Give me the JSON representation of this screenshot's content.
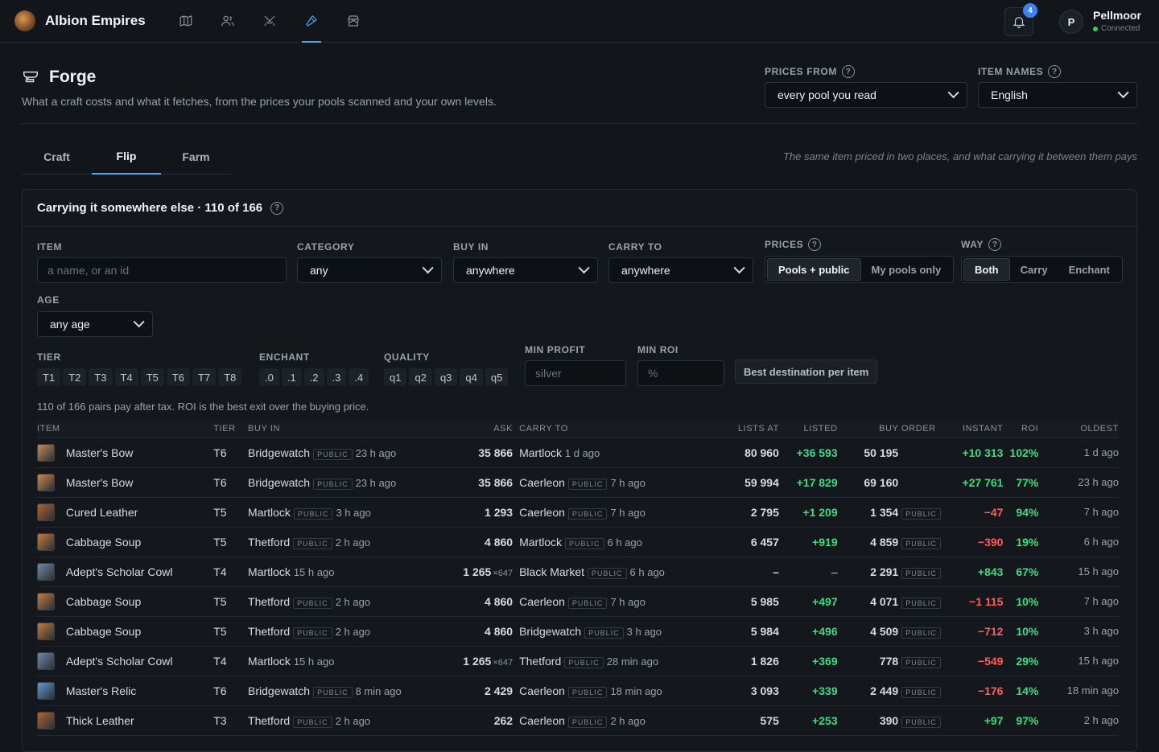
{
  "app": {
    "title": "Albion Empires",
    "notifications": "4",
    "user_initial": "P",
    "user_name": "Pellmoor",
    "user_status": "Connected"
  },
  "page": {
    "title": "Forge",
    "subtitle": "What a craft costs and what it fetches, from the prices your pools scanned and your own levels."
  },
  "prices_from": {
    "label": "PRICES FROM",
    "value": "every pool you read"
  },
  "item_names": {
    "label": "ITEM NAMES",
    "value": "English"
  },
  "tabs": [
    {
      "label": "Craft"
    },
    {
      "label": "Flip"
    },
    {
      "label": "Farm"
    }
  ],
  "tab_hint": "The same item priced in two places, and what carrying it between them pays",
  "card": {
    "title": "Carrying it somewhere else · 110 of 166"
  },
  "filters": {
    "item_label": "ITEM",
    "item_placeholder": "a name, or an id",
    "category_label": "CATEGORY",
    "category_value": "any",
    "buyin_label": "BUY IN",
    "buyin_value": "anywhere",
    "carryto_label": "CARRY TO",
    "carryto_value": "anywhere",
    "prices_label": "PRICES",
    "prices_options": [
      "Pools + public",
      "My pools only"
    ],
    "way_label": "WAY",
    "way_options": [
      "Both",
      "Carry",
      "Enchant"
    ],
    "age_label": "AGE",
    "age_value": "any age",
    "tier_label": "TIER",
    "tiers": [
      "T1",
      "T2",
      "T3",
      "T4",
      "T5",
      "T6",
      "T7",
      "T8"
    ],
    "enchant_label": "ENCHANT",
    "enchants": [
      ".0",
      ".1",
      ".2",
      ".3",
      ".4"
    ],
    "quality_label": "QUALITY",
    "qualities": [
      "q1",
      "q2",
      "q3",
      "q4",
      "q5"
    ],
    "min_profit_label": "MIN PROFIT",
    "min_profit_placeholder": "silver",
    "min_roi_label": "MIN ROI",
    "min_roi_placeholder": "%",
    "best_button": "Best destination per item"
  },
  "summary": "110 of 166 pairs pay after tax. ROI is the best exit over the buying price.",
  "columns": [
    "ITEM",
    "TIER",
    "BUY IN",
    "ASK",
    "CARRY TO",
    "LISTS AT",
    "LISTED",
    "BUY ORDER",
    "INSTANT",
    "ROI",
    "OLDEST"
  ],
  "public_tag": "PUBLIC",
  "rows": [
    {
      "item": "Master's Bow",
      "tier": "T6",
      "buy": "Bridgewatch",
      "buy_pub": true,
      "buy_ago": "23 h ago",
      "ask": "35 866",
      "mult": "",
      "carry": "Martlock",
      "carry_pub": false,
      "carry_ago": "1 d ago",
      "lists": "80 960",
      "listed": "+36 593",
      "order": "50 195",
      "order_pub": false,
      "instant": "+10 313",
      "roi": "102%",
      "oldest": "1 d ago",
      "color": "#c98a4a"
    },
    {
      "item": "Master's Bow",
      "tier": "T6",
      "buy": "Bridgewatch",
      "buy_pub": true,
      "buy_ago": "23 h ago",
      "ask": "35 866",
      "mult": "",
      "carry": "Caerleon",
      "carry_pub": true,
      "carry_ago": "7 h ago",
      "lists": "59 994",
      "listed": "+17 829",
      "order": "69 160",
      "order_pub": false,
      "instant": "+27 761",
      "roi": "77%",
      "oldest": "23 h ago",
      "color": "#c98a4a"
    },
    {
      "item": "Cured Leather",
      "tier": "T5",
      "buy": "Martlock",
      "buy_pub": true,
      "buy_ago": "3 h ago",
      "ask": "1 293",
      "mult": "",
      "carry": "Caerleon",
      "carry_pub": true,
      "carry_ago": "7 h ago",
      "lists": "2 795",
      "listed": "+1 209",
      "order": "1 354",
      "order_pub": true,
      "instant": "−47",
      "roi": "94%",
      "oldest": "7 h ago",
      "color": "#b4622e"
    },
    {
      "item": "Cabbage Soup",
      "tier": "T5",
      "buy": "Thetford",
      "buy_pub": true,
      "buy_ago": "2 h ago",
      "ask": "4 860",
      "mult": "",
      "carry": "Martlock",
      "carry_pub": true,
      "carry_ago": "6 h ago",
      "lists": "6 457",
      "listed": "+919",
      "order": "4 859",
      "order_pub": true,
      "instant": "−390",
      "roi": "19%",
      "oldest": "6 h ago",
      "color": "#c77a3c"
    },
    {
      "item": "Adept's Scholar Cowl",
      "tier": "T4",
      "buy": "Martlock",
      "buy_pub": false,
      "buy_ago": "15 h ago",
      "ask": "1 265",
      "mult": "×647",
      "carry": "Black Market",
      "carry_pub": true,
      "carry_ago": "6 h ago",
      "lists": "–",
      "listed": "–",
      "order": "2 291",
      "order_pub": true,
      "instant": "+843",
      "roi": "67%",
      "oldest": "15 h ago",
      "color": "#6f8aa8"
    },
    {
      "item": "Cabbage Soup",
      "tier": "T5",
      "buy": "Thetford",
      "buy_pub": true,
      "buy_ago": "2 h ago",
      "ask": "4 860",
      "mult": "",
      "carry": "Caerleon",
      "carry_pub": true,
      "carry_ago": "7 h ago",
      "lists": "5 985",
      "listed": "+497",
      "order": "4 071",
      "order_pub": true,
      "instant": "−1 115",
      "roi": "10%",
      "oldest": "7 h ago",
      "color": "#c77a3c"
    },
    {
      "item": "Cabbage Soup",
      "tier": "T5",
      "buy": "Thetford",
      "buy_pub": true,
      "buy_ago": "2 h ago",
      "ask": "4 860",
      "mult": "",
      "carry": "Bridgewatch",
      "carry_pub": true,
      "carry_ago": "3 h ago",
      "lists": "5 984",
      "listed": "+496",
      "order": "4 509",
      "order_pub": true,
      "instant": "−712",
      "roi": "10%",
      "oldest": "3 h ago",
      "color": "#c77a3c"
    },
    {
      "item": "Adept's Scholar Cowl",
      "tier": "T4",
      "buy": "Martlock",
      "buy_pub": false,
      "buy_ago": "15 h ago",
      "ask": "1 265",
      "mult": "×647",
      "carry": "Thetford",
      "carry_pub": true,
      "carry_ago": "28 min ago",
      "lists": "1 826",
      "listed": "+369",
      "order": "778",
      "order_pub": true,
      "instant": "−549",
      "roi": "29%",
      "oldest": "15 h ago",
      "color": "#6f8aa8"
    },
    {
      "item": "Master's Relic",
      "tier": "T6",
      "buy": "Bridgewatch",
      "buy_pub": true,
      "buy_ago": "8 min ago",
      "ask": "2 429",
      "mult": "",
      "carry": "Caerleon",
      "carry_pub": true,
      "carry_ago": "18 min ago",
      "lists": "3 093",
      "listed": "+339",
      "order": "2 449",
      "order_pub": true,
      "instant": "−176",
      "roi": "14%",
      "oldest": "18 min ago",
      "color": "#5b9bd5"
    },
    {
      "item": "Thick Leather",
      "tier": "T3",
      "buy": "Thetford",
      "buy_pub": true,
      "buy_ago": "2 h ago",
      "ask": "262",
      "mult": "",
      "carry": "Caerleon",
      "carry_pub": true,
      "carry_ago": "2 h ago",
      "lists": "575",
      "listed": "+253",
      "order": "390",
      "order_pub": true,
      "instant": "+97",
      "roi": "97%",
      "oldest": "2 h ago",
      "color": "#b4622e"
    }
  ]
}
